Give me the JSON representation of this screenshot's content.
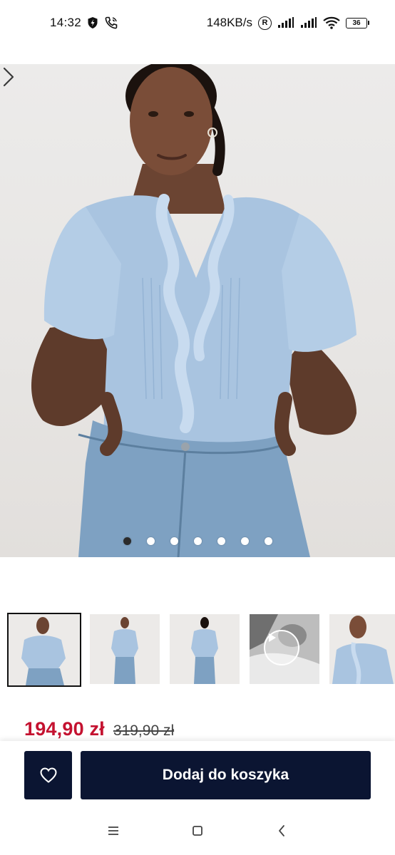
{
  "status_bar": {
    "time": "14:32",
    "network_speed": "148KB/s",
    "roaming_badge": "R",
    "battery_level": "36",
    "icons": [
      "shield-icon",
      "call-icon",
      "signal-icon",
      "signal-icon",
      "wifi-icon",
      "battery-icon"
    ]
  },
  "gallery": {
    "image_count": 7,
    "active_index": 0,
    "next_icon": "chevron-right-icon"
  },
  "thumbnails": [
    {
      "kind": "image",
      "selected": true
    },
    {
      "kind": "image",
      "selected": false
    },
    {
      "kind": "image",
      "selected": false
    },
    {
      "kind": "video",
      "selected": false,
      "icon": "play-icon"
    },
    {
      "kind": "image",
      "selected": false
    }
  ],
  "price": {
    "current": "194,90 zł",
    "original": "319,90 zł",
    "current_color": "#c41230"
  },
  "actions": {
    "wishlist_icon": "heart-icon",
    "add_to_cart_label": "Dodaj do koszyka",
    "button_color": "#0b1532"
  },
  "nav_bar": {
    "icons": [
      "menu-icon",
      "home-square-icon",
      "back-icon"
    ]
  }
}
